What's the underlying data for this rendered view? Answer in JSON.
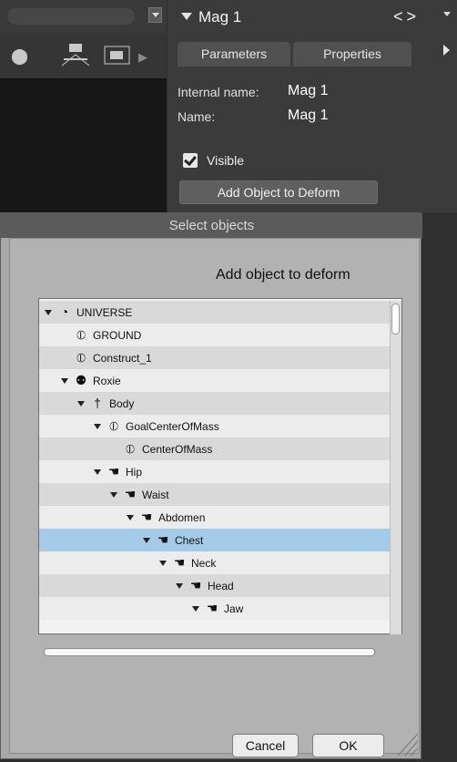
{
  "right_panel": {
    "title": "Mag 1",
    "nav_prev": "<",
    "nav_next": ">",
    "tabs": [
      {
        "label": "Parameters"
      },
      {
        "label": "Properties"
      }
    ],
    "internal_name_label": "Internal name:",
    "internal_name_value": "Mag 1",
    "name_label": "Name:",
    "name_value": "Mag 1",
    "visible_label": "Visible",
    "visible_checked": true,
    "add_object_button": "Add Object to Deform"
  },
  "dialog": {
    "title": "Select objects",
    "heading": "Add object to deform",
    "tree": [
      {
        "label": "UNIVERSE",
        "depth": 0,
        "expanded": true,
        "icon": "universe-icon",
        "glyph": "◔"
      },
      {
        "label": "GROUND",
        "depth": 1,
        "expanded": false,
        "icon": "prop-icon",
        "glyph": "⦶"
      },
      {
        "label": "Construct_1",
        "depth": 1,
        "expanded": false,
        "icon": "prop-icon",
        "glyph": "⦶"
      },
      {
        "label": "Roxie",
        "depth": 1,
        "expanded": true,
        "icon": "figure-icon",
        "glyph": "⚉"
      },
      {
        "label": "Body",
        "depth": 2,
        "expanded": true,
        "icon": "body-icon",
        "glyph": "†"
      },
      {
        "label": "GoalCenterOfMass",
        "depth": 3,
        "expanded": true,
        "icon": "prop-icon",
        "glyph": "⦶"
      },
      {
        "label": "CenterOfMass",
        "depth": 4,
        "expanded": false,
        "icon": "prop-icon",
        "glyph": "⦶"
      },
      {
        "label": "Hip",
        "depth": 3,
        "expanded": true,
        "icon": "hand-icon",
        "glyph": "☚"
      },
      {
        "label": "Waist",
        "depth": 4,
        "expanded": true,
        "icon": "hand-icon",
        "glyph": "☚"
      },
      {
        "label": "Abdomen",
        "depth": 5,
        "expanded": true,
        "icon": "hand-icon",
        "glyph": "☚"
      },
      {
        "label": "Chest",
        "depth": 6,
        "expanded": true,
        "icon": "hand-icon",
        "glyph": "☚",
        "selected": true
      },
      {
        "label": "Neck",
        "depth": 7,
        "expanded": true,
        "icon": "hand-icon",
        "glyph": "☚"
      },
      {
        "label": "Head",
        "depth": 8,
        "expanded": true,
        "icon": "hand-icon",
        "glyph": "☚"
      },
      {
        "label": "Jaw",
        "depth": 9,
        "expanded": true,
        "icon": "hand-icon",
        "glyph": "☚"
      }
    ],
    "cancel": "Cancel",
    "ok": "OK"
  },
  "colors": {
    "selection": "#a4cbe8",
    "panel_bg": "#3b3b3b",
    "dialog_bg": "#a8a8a8"
  }
}
